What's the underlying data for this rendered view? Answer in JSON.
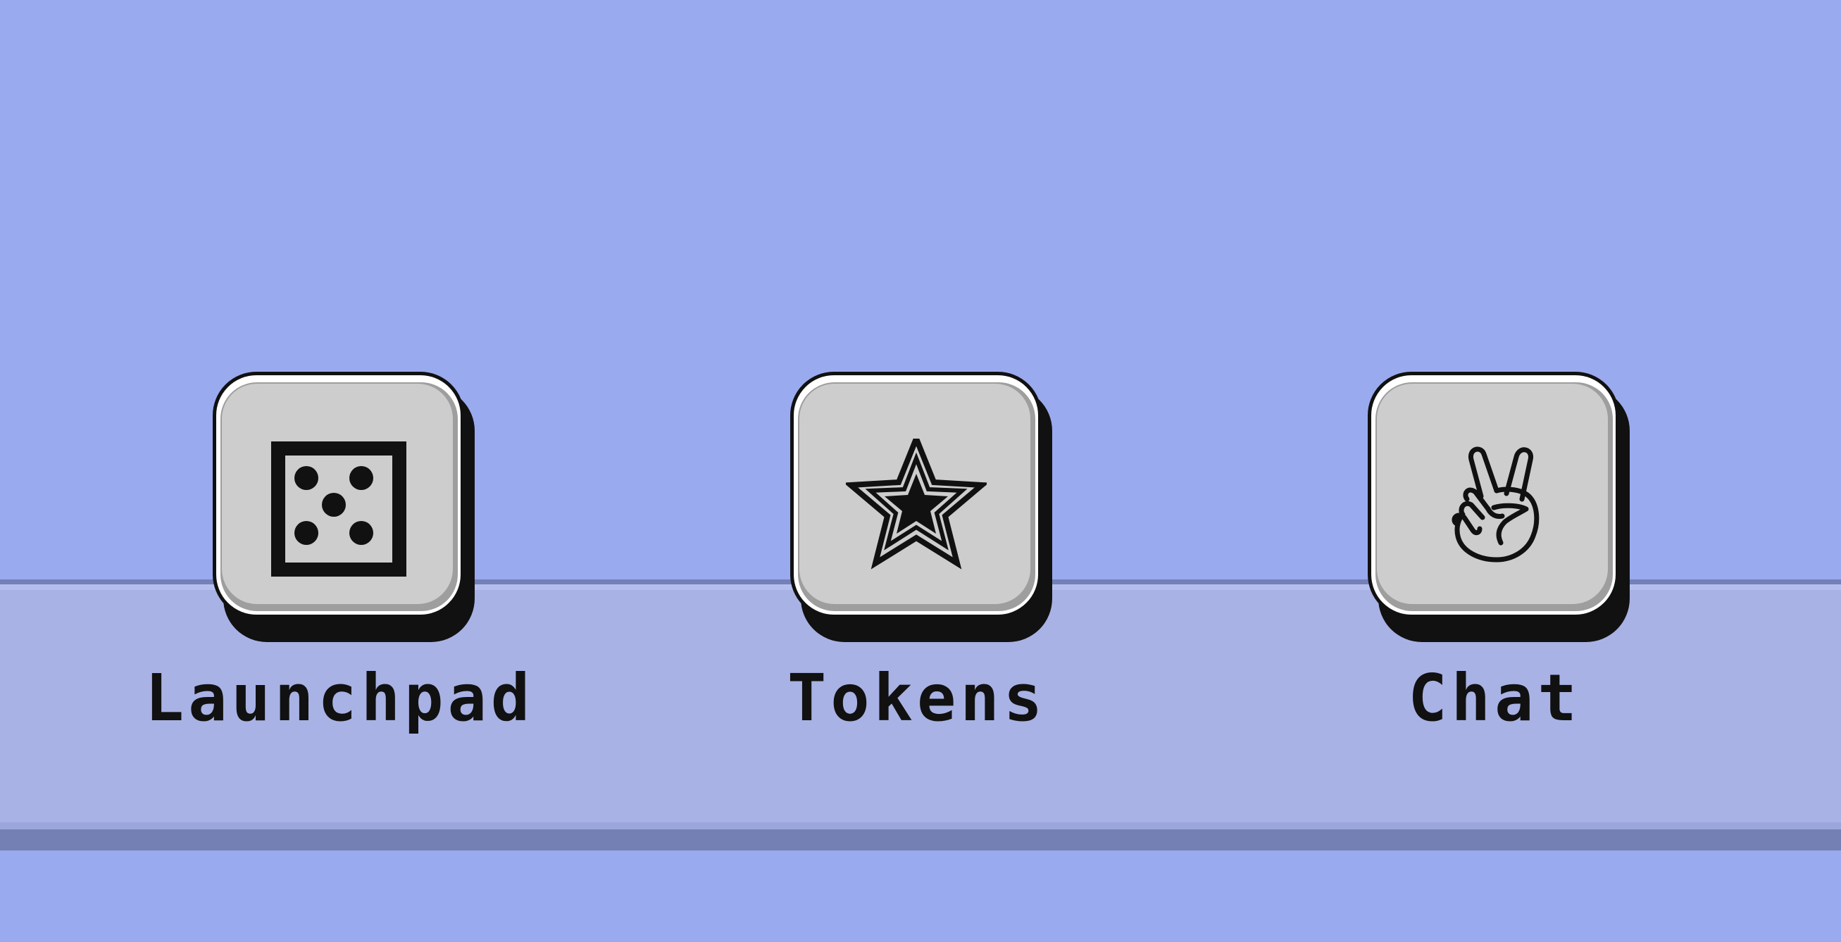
{
  "apps": [
    {
      "label": "Launchpad",
      "icon": "dice-five-icon"
    },
    {
      "label": "Tokens",
      "icon": "star-icon"
    },
    {
      "label": "Chat",
      "icon": "peace-hand-icon"
    }
  ],
  "colors": {
    "background": "#9aaaee",
    "shelf": "#a9b2e4",
    "shelf_edge": "#7480b4",
    "key_face": "#cdcdcd",
    "key_outline": "#111111"
  }
}
